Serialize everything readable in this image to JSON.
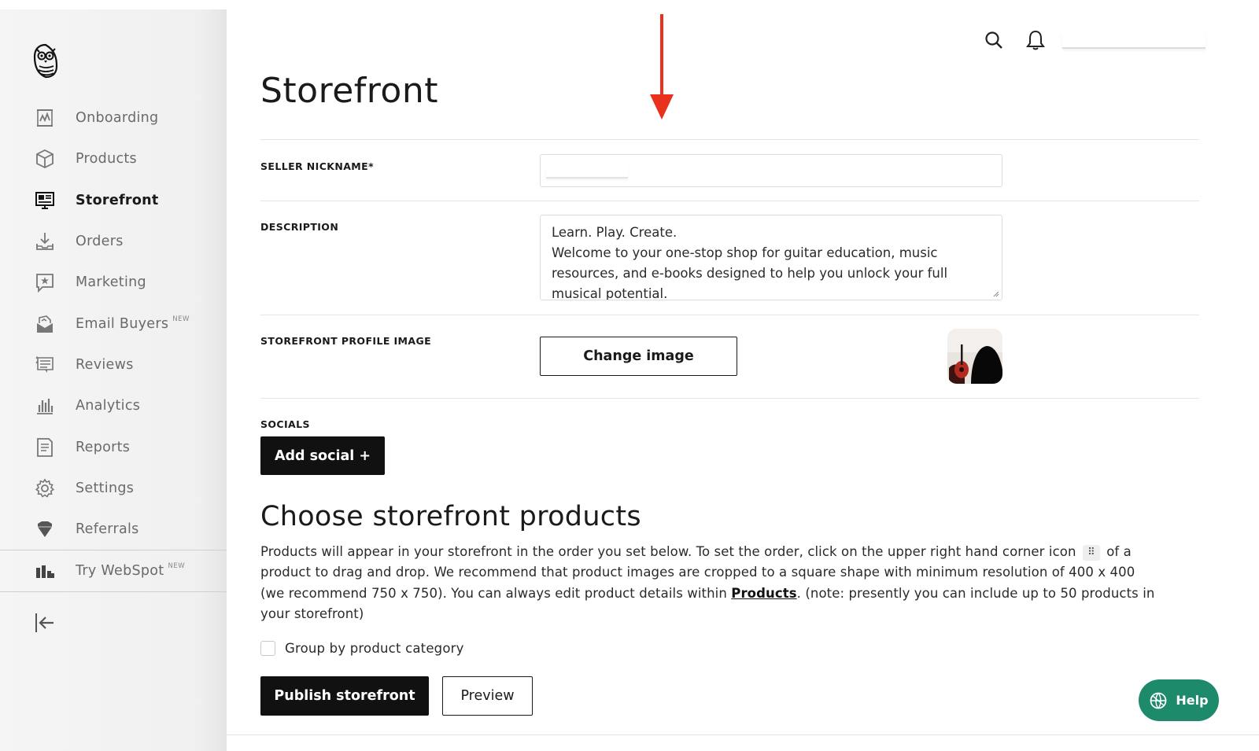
{
  "sidebar": {
    "items": [
      {
        "label": "Onboarding",
        "icon": "chart-board-icon"
      },
      {
        "label": "Products",
        "icon": "box-icon"
      },
      {
        "label": "Storefront",
        "icon": "storefront-icon",
        "active": true
      },
      {
        "label": "Orders",
        "icon": "download-tray-icon"
      },
      {
        "label": "Marketing",
        "icon": "star-chat-icon"
      },
      {
        "label": "Email Buyers",
        "icon": "email-megaphone-icon",
        "badge": "NEW"
      },
      {
        "label": "Reviews",
        "icon": "reviews-list-icon"
      },
      {
        "label": "Analytics",
        "icon": "bar-chart-icon"
      },
      {
        "label": "Reports",
        "icon": "document-icon"
      },
      {
        "label": "Settings",
        "icon": "gear-icon"
      },
      {
        "label": "Referrals",
        "icon": "diamond-heart-icon"
      }
    ],
    "webspot": {
      "label": "Try WebSpot",
      "badge": "NEW",
      "icon": "webspot-icon"
    },
    "logout_icon": "logout-icon"
  },
  "header": {
    "title": "Storefront",
    "search_icon": "search-icon",
    "bell_icon": "bell-icon"
  },
  "form": {
    "nickname_label": "SELLER NICKNAME*",
    "description_label": "DESCRIPTION",
    "description_lines": [
      "Learn. Play. Create.",
      "Welcome to your one-stop shop for guitar education, music",
      "resources, and e-books designed to help you unlock your full",
      "musical potential."
    ],
    "profile_image_label": "STOREFRONT PROFILE IMAGE",
    "change_image_label": "Change image",
    "socials_label": "SOCIALS",
    "add_social_label": "Add social +"
  },
  "products_section": {
    "title": "Choose storefront products",
    "para_line1_a": "Products will appear in your storefront in the order you set below. To set the order, click on the upper right hand corner icon",
    "drag_icon_glyph": "⠿",
    "para_line1_b": "of a",
    "para_line2": "product to drag and drop. We recommend that product images are cropped to a square shape with minimum resolution of 400 x 400",
    "para_line3_a": "(we recommend 750 x 750). You can always edit product details within",
    "products_link": "Products",
    "para_line3_b": ". (note: presently you can include up to 50 products in",
    "para_line4": "your storefront)",
    "group_label": "Group by product category",
    "group_checked": false,
    "publish_label": "Publish storefront",
    "preview_label": "Preview"
  },
  "help": {
    "label": "Help",
    "icon": "help-globe-icon"
  },
  "colors": {
    "help_bg": "#1e8a6c",
    "arrow": "#e8321e",
    "primary_btn": "#111111"
  }
}
